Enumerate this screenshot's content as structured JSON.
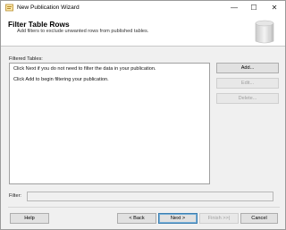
{
  "window": {
    "title": "New Publication Wizard",
    "minimize_glyph": "—",
    "maximize_glyph": "☐",
    "close_glyph": "✕"
  },
  "header": {
    "title": "Filter Table Rows",
    "subtitle": "Add filters to exclude unwanted rows from published tables."
  },
  "filtered_tables": {
    "label": "Filtered Tables:",
    "lines": [
      "Click Next if you do not need to filter the data in your publication.",
      "Click Add to begin filtering your publication."
    ]
  },
  "side_buttons": {
    "add": "Add...",
    "edit": "Edit...",
    "delete": "Delete..."
  },
  "filter": {
    "label": "Filter:",
    "value": ""
  },
  "footer": {
    "help": "Help",
    "back": "< Back",
    "next": "Next >",
    "finish": "Finish >>|",
    "cancel": "Cancel"
  },
  "colors": {
    "accent_border": "#3c7fb1",
    "window_bg": "#f0f0f0"
  },
  "icons": [
    "wizard-app-icon",
    "minimize-icon",
    "maximize-icon",
    "close-icon",
    "wizard-header-graphic"
  ]
}
